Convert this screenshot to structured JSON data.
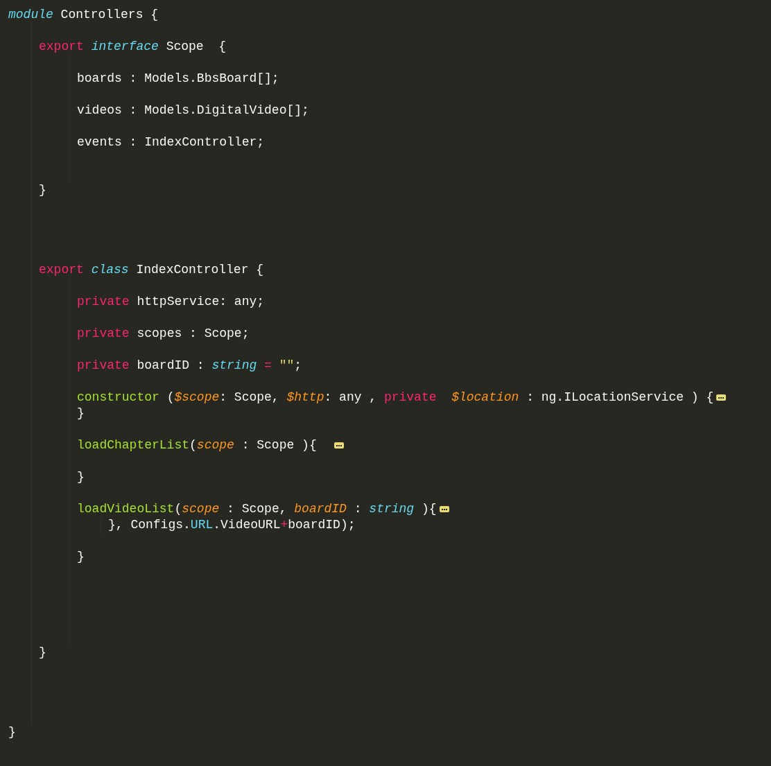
{
  "editor": {
    "lines": [
      {
        "kind": "code",
        "tokens": [
          {
            "kind": "storage",
            "text": "module"
          },
          {
            "kind": "plain",
            "text": " Controllers {"
          }
        ],
        "children": [
          {
            "kind": "blank"
          },
          {
            "kind": "code",
            "tokens": [
              {
                "kind": "keyword",
                "text": "export "
              },
              {
                "kind": "storage",
                "text": "interface"
              },
              {
                "kind": "plain",
                "text": " Scope  {"
              }
            ],
            "children": [
              {
                "kind": "blank"
              },
              {
                "kind": "code",
                "tokens": [
                  {
                    "kind": "plain",
                    "text": "boards : Models.BbsBoard[];"
                  }
                ]
              },
              {
                "kind": "blank"
              },
              {
                "kind": "code",
                "tokens": [
                  {
                    "kind": "plain",
                    "text": "videos : Models.DigitalVideo[];"
                  }
                ]
              },
              {
                "kind": "blank"
              },
              {
                "kind": "code",
                "tokens": [
                  {
                    "kind": "plain",
                    "text": "events : IndexController;"
                  }
                ]
              },
              {
                "kind": "blank"
              },
              {
                "kind": "blank"
              }
            ]
          },
          {
            "kind": "code",
            "tokens": [
              {
                "kind": "plain",
                "text": "}"
              }
            ]
          },
          {
            "kind": "blank"
          },
          {
            "kind": "blank"
          },
          {
            "kind": "blank"
          },
          {
            "kind": "blank"
          },
          {
            "kind": "code",
            "tokens": [
              {
                "kind": "keyword",
                "text": "export "
              },
              {
                "kind": "storage",
                "text": "class"
              },
              {
                "kind": "plain",
                "text": " IndexController {"
              }
            ],
            "children": [
              {
                "kind": "blank"
              },
              {
                "kind": "code",
                "tokens": [
                  {
                    "kind": "keyword",
                    "text": "private"
                  },
                  {
                    "kind": "plain",
                    "text": " httpService: any;"
                  }
                ]
              },
              {
                "kind": "blank"
              },
              {
                "kind": "code",
                "tokens": [
                  {
                    "kind": "keyword",
                    "text": "private"
                  },
                  {
                    "kind": "plain",
                    "text": " scopes : Scope;"
                  }
                ]
              },
              {
                "kind": "blank"
              },
              {
                "kind": "code",
                "tokens": [
                  {
                    "kind": "keyword",
                    "text": "private"
                  },
                  {
                    "kind": "plain",
                    "text": " boardID : "
                  },
                  {
                    "kind": "storage",
                    "text": "string "
                  },
                  {
                    "kind": "keyword",
                    "text": "= "
                  },
                  {
                    "kind": "string",
                    "text": "\"\""
                  },
                  {
                    "kind": "plain",
                    "text": ";"
                  }
                ]
              },
              {
                "kind": "blank"
              },
              {
                "kind": "code",
                "folded": true,
                "tokens": [
                  {
                    "kind": "function",
                    "text": "constructor"
                  },
                  {
                    "kind": "plain",
                    "text": " ("
                  },
                  {
                    "kind": "param",
                    "text": "$scope"
                  },
                  {
                    "kind": "plain",
                    "text": ": Scope, "
                  },
                  {
                    "kind": "param",
                    "text": "$http"
                  },
                  {
                    "kind": "plain",
                    "text": ": any , "
                  },
                  {
                    "kind": "keyword",
                    "text": "private  "
                  },
                  {
                    "kind": "param",
                    "text": "$location"
                  },
                  {
                    "kind": "plain",
                    "text": " : ng.ILocationService ) {"
                  }
                ]
              },
              {
                "kind": "code",
                "tokens": [
                  {
                    "kind": "plain",
                    "text": "}"
                  }
                ]
              },
              {
                "kind": "blank"
              },
              {
                "kind": "code",
                "folded": true,
                "tokens": [
                  {
                    "kind": "function",
                    "text": "loadChapterList"
                  },
                  {
                    "kind": "plain",
                    "text": "("
                  },
                  {
                    "kind": "param",
                    "text": "scope"
                  },
                  {
                    "kind": "plain",
                    "text": " : Scope ){  "
                  }
                ]
              },
              {
                "kind": "blank"
              },
              {
                "kind": "code",
                "tokens": [
                  {
                    "kind": "plain",
                    "text": "}"
                  }
                ]
              },
              {
                "kind": "blank"
              },
              {
                "kind": "code",
                "folded": true,
                "tokens": [
                  {
                    "kind": "function",
                    "text": "loadVideoList"
                  },
                  {
                    "kind": "plain",
                    "text": "("
                  },
                  {
                    "kind": "param",
                    "text": "scope"
                  },
                  {
                    "kind": "plain",
                    "text": " : Scope, "
                  },
                  {
                    "kind": "param",
                    "text": "boardID"
                  },
                  {
                    "kind": "plain",
                    "text": " : "
                  },
                  {
                    "kind": "storage",
                    "text": "string"
                  },
                  {
                    "kind": "plain",
                    "text": " ){"
                  }
                ],
                "children": [
                  {
                    "kind": "code",
                    "tokens": [
                      {
                        "kind": "plain",
                        "text": "}, Configs."
                      },
                      {
                        "kind": "support",
                        "text": "URL"
                      },
                      {
                        "kind": "plain",
                        "text": ".VideoURL"
                      },
                      {
                        "kind": "keyword",
                        "text": "+"
                      },
                      {
                        "kind": "plain",
                        "text": "boardID);"
                      }
                    ]
                  }
                ]
              },
              {
                "kind": "blank"
              },
              {
                "kind": "code",
                "tokens": [
                  {
                    "kind": "plain",
                    "text": "}"
                  }
                ]
              },
              {
                "kind": "blank"
              },
              {
                "kind": "blank"
              },
              {
                "kind": "blank"
              },
              {
                "kind": "blank"
              },
              {
                "kind": "blank"
              }
            ]
          },
          {
            "kind": "code",
            "tokens": [
              {
                "kind": "plain",
                "text": "}"
              }
            ]
          },
          {
            "kind": "blank"
          },
          {
            "kind": "blank"
          },
          {
            "kind": "blank"
          },
          {
            "kind": "blank"
          }
        ]
      },
      {
        "kind": "code",
        "tokens": [
          {
            "kind": "plain",
            "text": "}"
          }
        ]
      }
    ]
  }
}
